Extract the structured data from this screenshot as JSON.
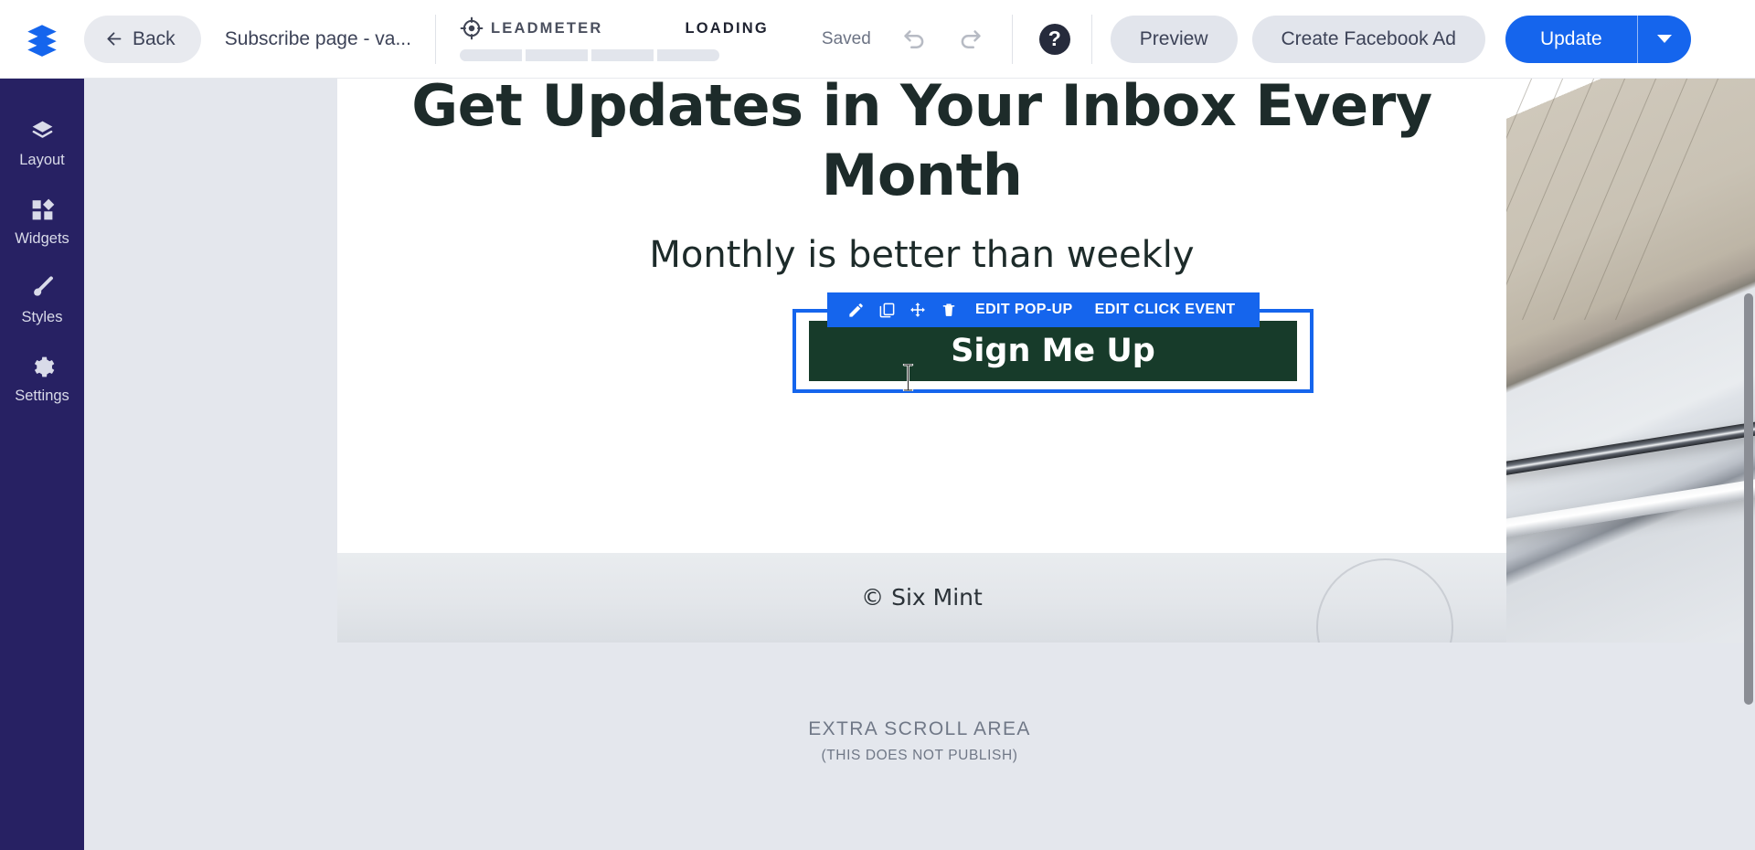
{
  "topbar": {
    "logo_icon": "layers-logo-icon",
    "back_label": "Back",
    "back_icon": "arrow-left-icon",
    "page_title": "Subscribe page - va...",
    "leadmeter": {
      "icon": "target-icon",
      "label": "LEADMETER",
      "status": "LOADING",
      "segments": 4
    },
    "saved_label": "Saved",
    "undo_icon": "undo-arrow-icon",
    "redo_icon": "redo-arrow-icon",
    "help_label": "?",
    "preview_label": "Preview",
    "create_fb_ad_label": "Create Facebook Ad",
    "update_label": "Update",
    "update_caret_icon": "chevron-down-icon",
    "accent_blue": "#1565ed",
    "pill_grey": "#e2e5ec"
  },
  "sidebar": {
    "background": "#272163",
    "items": [
      {
        "icon": "layers-icon",
        "label": "Layout"
      },
      {
        "icon": "widgets-icon",
        "label": "Widgets"
      },
      {
        "icon": "brush-icon",
        "label": "Styles"
      },
      {
        "icon": "gear-icon",
        "label": "Settings"
      }
    ]
  },
  "canvas": {
    "background": "#e4e7ed",
    "hero": {
      "heading": "Get Updates in Your Inbox Every Month",
      "subheading": "Monthly is better than weekly",
      "heading_color": "#1d2b2a"
    },
    "selected_widget": {
      "type": "button",
      "button_label": "Sign Me Up",
      "button_color": "#173b2a",
      "selection_color": "#1565ed",
      "toolbar": {
        "icons": [
          {
            "name": "pencil-icon",
            "title": "Edit"
          },
          {
            "name": "duplicate-icon",
            "title": "Duplicate"
          },
          {
            "name": "move-icon",
            "title": "Move"
          },
          {
            "name": "trash-icon",
            "title": "Delete"
          }
        ],
        "actions": [
          "EDIT POP-UP",
          "EDIT CLICK EVENT"
        ]
      },
      "cursor": "text-ibeam-cursor"
    },
    "footer": {
      "copyright": "© Six Mint"
    },
    "extra_scroll": {
      "title": "EXTRA SCROLL AREA",
      "note": "(THIS DOES NOT PUBLISH)"
    }
  },
  "scrollbar": {
    "orientation": "vertical",
    "thumb_color": "#8a8d94"
  }
}
